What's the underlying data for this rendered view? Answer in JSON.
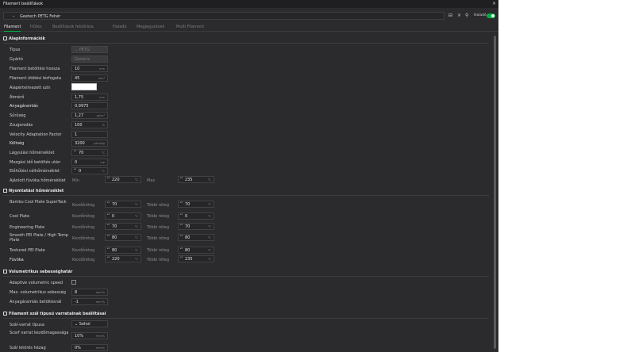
{
  "window": {
    "title": "Filament beállítások",
    "close": "×"
  },
  "toolbar": {
    "preset_chevron": "⌄",
    "preset_name": "Geetech PETG Fehér",
    "save_icon": "⊟",
    "delete_icon": "×",
    "search_icon": "⚲",
    "advanced_label": "Haladó"
  },
  "tabs": [
    "Filament",
    "Hűtés",
    "Beállítások felülírása",
    "Haladó",
    "Megjegyzések",
    "Multi Filament"
  ],
  "sections": {
    "basic": "Alapinformációk",
    "print_temp": "Nyomtatási hőmérséklet",
    "vol_speed": "Volumetrikus sebességhatár",
    "seam": "Filament szál típusú varratainak beállításai"
  },
  "basic": [
    {
      "label": "Típus",
      "value": "⌄ PETG"
    },
    {
      "label": "Gyártó",
      "value": "Generic"
    },
    {
      "label": "Filament betöltési hossza",
      "value": "10",
      "unit": "mm"
    },
    {
      "label": "Filament ütötési térfogata",
      "value": "45",
      "unit": "mm³"
    },
    {
      "label": "Alapértelmezett szín"
    },
    {
      "label": "Átmérő",
      "value": "1,75",
      "unit": "mm"
    },
    {
      "label": "Anyagáramlás",
      "value": "0,9975"
    },
    {
      "label": "Sűrűség",
      "value": "1,27",
      "unit": "g/cm³"
    },
    {
      "label": "Zsugorodás",
      "value": "100",
      "unit": "%"
    },
    {
      "label": "Velocity Adaptation Factor",
      "value": "1"
    },
    {
      "label": "Költség",
      "value": "3200",
      "unit": "pénz/kg"
    },
    {
      "label": "Lágyulási hőmérséklet",
      "value": "70",
      "unit": "°C"
    },
    {
      "label": "Mozgási idő betöltés után",
      "value": "0",
      "unit": "mp"
    },
    {
      "label": "Előhűtési célhőmérséklet",
      "value": "0",
      "unit": "°C"
    },
    {
      "label": "Ajánlott fúvóka hőmérséklet",
      "min_label": "Min",
      "min": "220",
      "max_label": "Max",
      "max": "235",
      "unit": "°C"
    }
  ],
  "temps": {
    "first_label": "Kezdőréteg",
    "other_label": "Többi réteg",
    "unit": "°C",
    "rows": [
      {
        "label": "Bambu Cool Plate SuperTack",
        "first": "70",
        "other": "70"
      },
      {
        "label": "Cool Plate",
        "first": "0",
        "other": "0"
      },
      {
        "label": "Engineering Plate",
        "first": "70",
        "other": "70"
      },
      {
        "label": "Smooth PEI Plate / High Temp Plate",
        "first": "80",
        "other": "80"
      },
      {
        "label": "Textured PEI Plate",
        "first": "80",
        "other": "80"
      },
      {
        "label": "Fúvóka",
        "first": "220",
        "other": "235"
      }
    ]
  },
  "vol": [
    {
      "label": "Adaptive volumetric speed"
    },
    {
      "label": "Max. volumetrikus sebesség",
      "value": "8",
      "unit": "mm³/s"
    },
    {
      "label": "Anyagáramlás betöltésnál",
      "value": "-1",
      "unit": "mm³/s"
    }
  ],
  "seam": [
    {
      "label": "Szál-varrat típusa",
      "value": "⌄ Sehol"
    },
    {
      "label": "Scarf varrat kezdőmagassága",
      "value": "10%",
      "unit": "mm/%"
    },
    {
      "label": "Szál letörés hézag",
      "value": "0%",
      "unit": "mm/%"
    }
  ],
  "spin_glyphs": "▴▾"
}
